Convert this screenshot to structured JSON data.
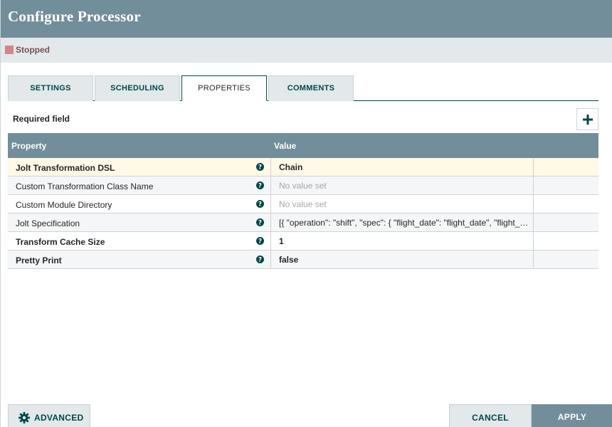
{
  "dialog": {
    "title": "Configure Processor",
    "status": {
      "text": "Stopped",
      "color": "#d18686"
    }
  },
  "tabs": [
    {
      "label": "SETTINGS",
      "active": false
    },
    {
      "label": "SCHEDULING",
      "active": false
    },
    {
      "label": "PROPERTIES",
      "active": true
    },
    {
      "label": "COMMENTS",
      "active": false
    }
  ],
  "properties": {
    "required_label": "Required field",
    "add_icon": "plus-icon",
    "columns": {
      "property": "Property",
      "value": "Value"
    },
    "rows": [
      {
        "name": "Jolt Transformation DSL",
        "value": "Chain",
        "required": true,
        "empty": false
      },
      {
        "name": "Custom Transformation Class Name",
        "value": "No value set",
        "required": false,
        "empty": true
      },
      {
        "name": "Custom Module Directory",
        "value": "No value set",
        "required": false,
        "empty": true
      },
      {
        "name": "Jolt Specification",
        "value": "[{ \"operation\": \"shift\", \"spec\": { \"flight_date\": \"flight_date\", \"flight_…",
        "required": false,
        "empty": false
      },
      {
        "name": "Transform Cache Size",
        "value": "1",
        "required": true,
        "empty": false
      },
      {
        "name": "Pretty Print",
        "value": "false",
        "required": true,
        "empty": false
      }
    ]
  },
  "footer": {
    "advanced_label": "ADVANCED",
    "advanced_icon": "gear-icon",
    "cancel_label": "CANCEL",
    "apply_label": "APPLY"
  },
  "colors": {
    "header": "#728e9b",
    "accent": "#004849",
    "selected_row": "#fff9e6"
  }
}
